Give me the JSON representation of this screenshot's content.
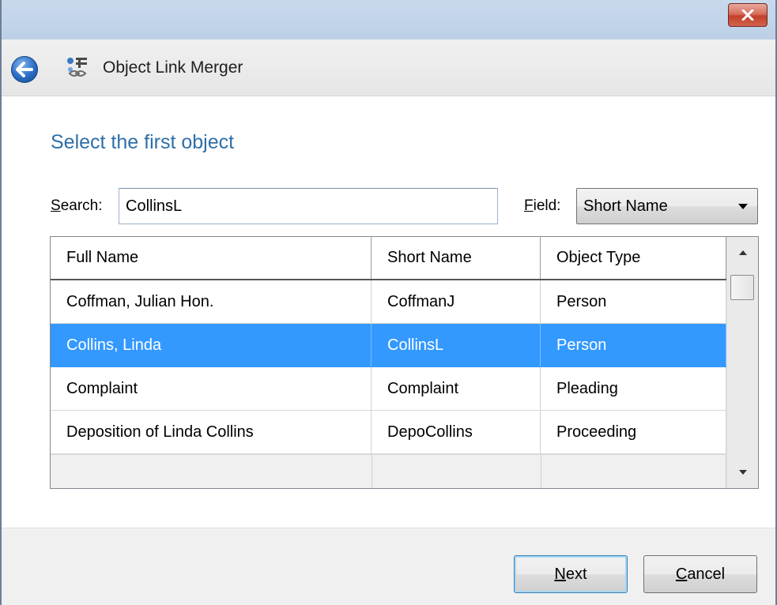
{
  "window": {
    "close_icon": "close-icon"
  },
  "header": {
    "title": "Object Link Merger",
    "back_icon": "back-arrow-icon",
    "app_icon": "link-merger-icon"
  },
  "main": {
    "heading": "Select the first object",
    "search": {
      "label_access": "S",
      "label_rest": "earch:",
      "value": "CollinsL"
    },
    "field": {
      "label_access": "F",
      "label_rest": "ield:",
      "selected": "Short Name"
    },
    "grid": {
      "columns": [
        "Full Name",
        "Short Name",
        "Object Type"
      ],
      "rows": [
        [
          "Coffman, Julian Hon.",
          "CoffmanJ",
          "Person"
        ],
        [
          "Collins, Linda",
          "CollinsL",
          "Person"
        ],
        [
          "Complaint",
          "Complaint",
          "Pleading"
        ],
        [
          "Deposition of Linda Collins",
          "DepoCollins",
          "Proceeding"
        ]
      ],
      "selected_row": 1
    }
  },
  "footer": {
    "next_access": "N",
    "next_rest": "ext",
    "cancel_access": "C",
    "cancel_rest": "ancel"
  },
  "colors": {
    "selection": "#3399ff",
    "heading": "#2f6fa8"
  }
}
